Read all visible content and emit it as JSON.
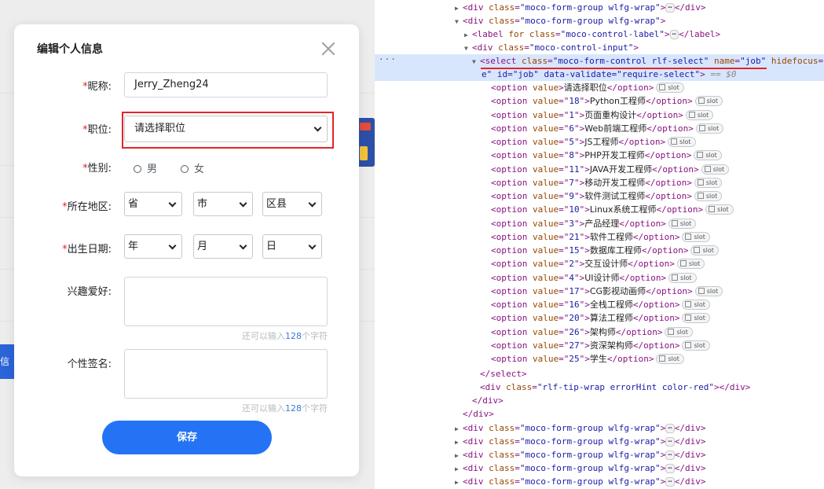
{
  "modal": {
    "title": "编辑个人信息",
    "nickname_label": "昵称:",
    "nickname_value": "Jerry_Zheng24",
    "job_label": "职位:",
    "job_value": "请选择职位",
    "gender_label": "性别:",
    "gender_male": "男",
    "gender_female": "女",
    "region_label": "所在地区:",
    "province": "省",
    "city": "市",
    "district": "区县",
    "birth_label": "出生日期:",
    "year": "年",
    "month": "月",
    "day": "日",
    "hobby_label": "兴趣爱好:",
    "hobby_value": "",
    "signature_label": "个性签名:",
    "signature_value": "",
    "hint_prefix": "还可以输入",
    "hint_count": "128",
    "hint_suffix": "个字符",
    "required_mark": "*",
    "save_label": "保存"
  },
  "background": {
    "tab_text": "信息"
  },
  "devtools": {
    "ellipsis": "⋯",
    "slot_label": "slot",
    "collapsed_group": "div class=\"moco-form-group wlfg-wrap\"",
    "select_tail": "e\" id=\"job\" data-validate=\"require-select\"",
    "select_eq": "== $0",
    "options": [
      {
        "value": "",
        "text": "请选择职位",
        "has_value_attr": false
      },
      {
        "value": "18",
        "text": "Python工程师"
      },
      {
        "value": "1",
        "text": "页面重构设计"
      },
      {
        "value": "6",
        "text": "Web前端工程师"
      },
      {
        "value": "5",
        "text": "JS工程师"
      },
      {
        "value": "8",
        "text": "PHP开发工程师"
      },
      {
        "value": "11",
        "text": "JAVA开发工程师"
      },
      {
        "value": "7",
        "text": "移动开发工程师"
      },
      {
        "value": "9",
        "text": "软件测试工程师"
      },
      {
        "value": "10",
        "text": "Linux系统工程师"
      },
      {
        "value": "3",
        "text": "产品经理"
      },
      {
        "value": "21",
        "text": "软件工程师"
      },
      {
        "value": "15",
        "text": "数据库工程师"
      },
      {
        "value": "2",
        "text": "交互设计师"
      },
      {
        "value": "4",
        "text": "UI设计师"
      },
      {
        "value": "17",
        "text": "CG影视动画师"
      },
      {
        "value": "16",
        "text": "全栈工程师"
      },
      {
        "value": "20",
        "text": "算法工程师"
      },
      {
        "value": "26",
        "text": "架构师"
      },
      {
        "value": "27",
        "text": "资深架构师"
      },
      {
        "value": "25",
        "text": "学生"
      }
    ]
  },
  "colors": {
    "primary": "#2473f5",
    "required": "#e02424",
    "highlight": "#e3242b",
    "selected_row": "#d8e6fd"
  }
}
